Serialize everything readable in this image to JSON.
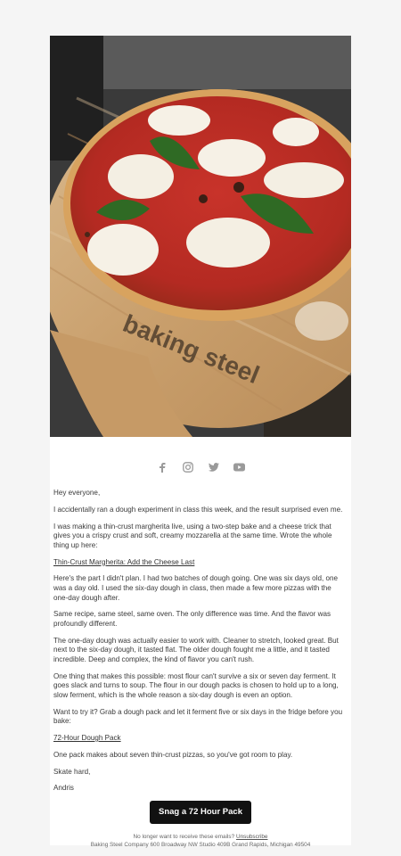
{
  "hero": {
    "image_alt": "Margherita pizza on a wooden baking steel peel",
    "peel_text": "baking steel"
  },
  "social": [
    {
      "name": "facebook-icon",
      "glyph": "f"
    },
    {
      "name": "instagram-icon",
      "glyph": ""
    },
    {
      "name": "twitter-icon",
      "glyph": ""
    },
    {
      "name": "youtube-icon",
      "glyph": ""
    }
  ],
  "email": {
    "greeting": "Hey everyone,",
    "p1": "I accidentally ran a dough experiment in class this week, and the result surprised even me.",
    "p2": "I was making a thin-crust margherita live, using a two-step bake and a cheese trick that gives you a crispy crust and soft, creamy mozzarella at the same time. Wrote the whole thing up here:",
    "link1": "Thin-Crust Margherita: Add the Cheese Last",
    "p3": "Here's the part I didn't plan. I had two batches of dough going. One was six days old, one was a day old. I used the six-day dough in class, then made a few more pizzas with the one-day dough after.",
    "p4": "Same recipe, same steel, same oven. The only difference was time. And the flavor was profoundly different.",
    "p5": "The one-day dough was actually easier to work with. Cleaner to stretch, looked great. But next to the six-day dough, it tasted flat. The older dough fought me a little, and it tasted incredible. Deep and complex, the kind of flavor you can't rush.",
    "p6": "One thing that makes this possible: most flour can't survive a six or seven day ferment. It goes slack and turns to soup. The flour in our dough packs is chosen to hold up to a long, slow ferment, which is the whole reason a six-day dough is even an option.",
    "p7": "Want to try it? Grab a dough pack and let it ferment five or six days in the fridge before you bake:",
    "link2": "72-Hour Dough Pack",
    "p8": "One pack makes about seven thin-crust pizzas, so you've got room to play.",
    "signoff": "Skate hard,",
    "name": "Andris"
  },
  "cta": {
    "label": "Snag a 72 Hour Pack"
  },
  "footer": {
    "unsubscribe_prefix": "No longer want to receive these emails?",
    "unsubscribe_link": "Unsubscribe",
    "address": "Baking Steel Company 600 Broadway NW Studio 409B Grand Rapids, Michigan 49504"
  }
}
